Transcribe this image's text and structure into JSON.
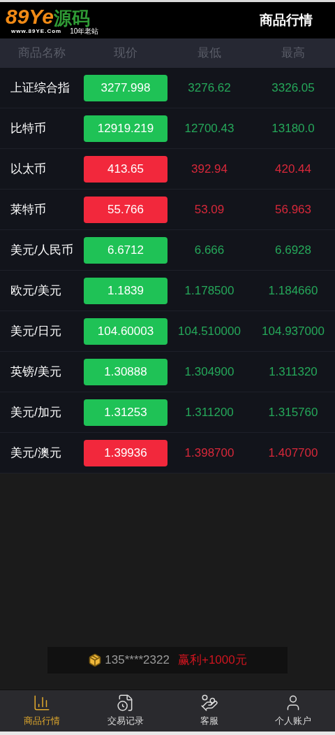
{
  "header": {
    "logo": {
      "main": "89Ye",
      "accent": "源码",
      "url": "www.89YE.Com",
      "slogan": "10年老站"
    },
    "title": "商品行情"
  },
  "table": {
    "columns": [
      "商品名称",
      "现价",
      "最低",
      "最高"
    ],
    "rows": [
      {
        "name": "上证综合指",
        "price": "3277.998",
        "low": "3276.62",
        "high": "3326.05",
        "kind": "up"
      },
      {
        "name": "比特币",
        "price": "12919.219",
        "low": "12700.43",
        "high": "13180.0",
        "kind": "up"
      },
      {
        "name": "以太币",
        "price": "413.65",
        "low": "392.94",
        "high": "420.44",
        "kind": "down"
      },
      {
        "name": "莱特币",
        "price": "55.766",
        "low": "53.09",
        "high": "56.963",
        "kind": "down"
      },
      {
        "name": "美元/人民币",
        "price": "6.6712",
        "low": "6.666",
        "high": "6.6928",
        "kind": "up"
      },
      {
        "name": "欧元/美元",
        "price": "1.1839",
        "low": "1.178500",
        "high": "1.184660",
        "kind": "up"
      },
      {
        "name": "美元/日元",
        "price": "104.60003",
        "low": "104.510000",
        "high": "104.937000",
        "kind": "up"
      },
      {
        "name": "英镑/美元",
        "price": "1.30888",
        "low": "1.304900",
        "high": "1.311320",
        "kind": "up"
      },
      {
        "name": "美元/加元",
        "price": "1.31253",
        "low": "1.311200",
        "high": "1.315760",
        "kind": "up"
      },
      {
        "name": "美元/澳元",
        "price": "1.39936",
        "low": "1.398700",
        "high": "1.407700",
        "kind": "down"
      }
    ]
  },
  "notice": {
    "user": "135****2322",
    "profit": "赢利+1000元"
  },
  "tabs": [
    {
      "label": "商品行情",
      "kind": "chart",
      "selected": true
    },
    {
      "label": "交易记录",
      "kind": "record",
      "selected": false
    },
    {
      "label": "客服",
      "kind": "service",
      "selected": false
    },
    {
      "label": "个人账户",
      "kind": "account",
      "selected": false
    }
  ]
}
